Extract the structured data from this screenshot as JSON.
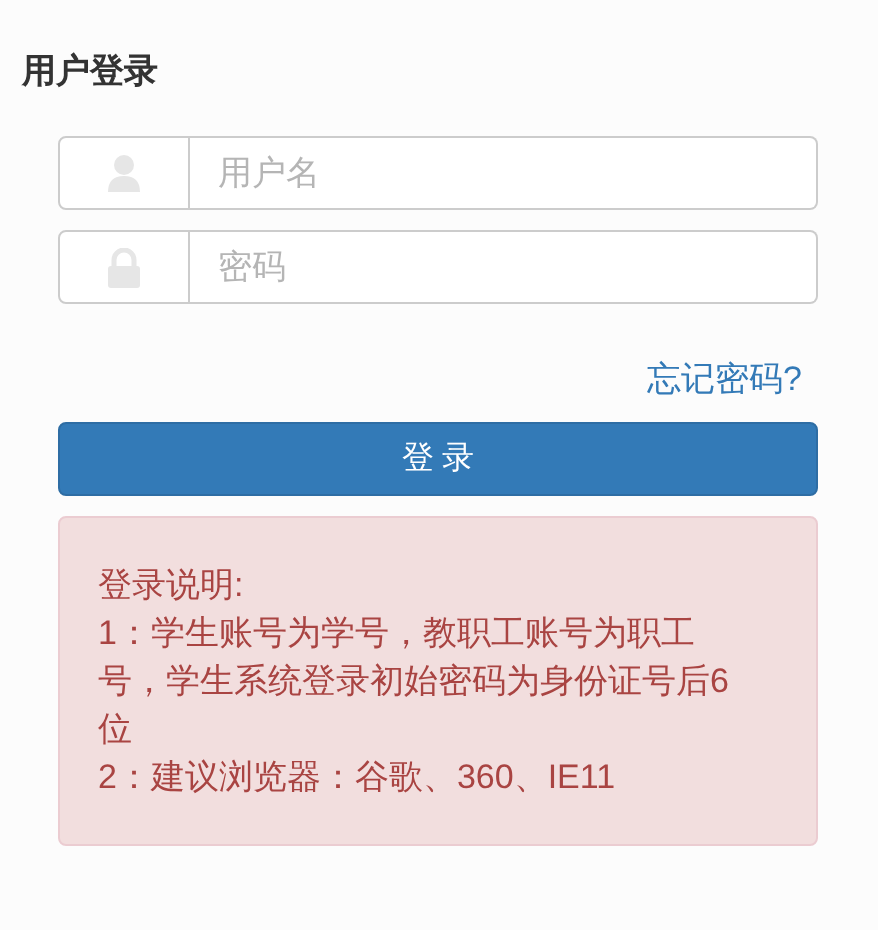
{
  "title": "用户登录",
  "fields": [
    {
      "kind": "user",
      "placeholder": "用户名"
    },
    {
      "kind": "lock",
      "placeholder": "密码"
    }
  ],
  "forgot_link": "忘记密码?",
  "login_button": "登 录",
  "notice": [
    "登录说明:",
    "1：学生账号为学号，教职工账号为职工号，学生系统登录初始密码为身份证号后6位",
    "2：建议浏览器：谷歌、360、IE11"
  ]
}
